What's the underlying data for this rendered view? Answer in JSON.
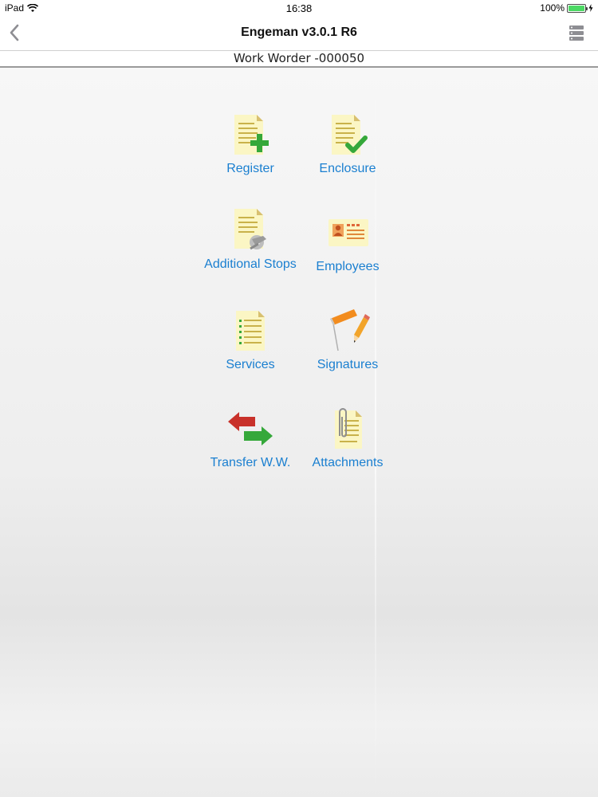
{
  "status": {
    "device": "iPad",
    "time": "16:38",
    "battery": "100%"
  },
  "nav": {
    "title": "Engeman v3.0.1 R6"
  },
  "subheader": {
    "text": "Work Worder -000050"
  },
  "menu": {
    "register": "Register",
    "enclosure": "Enclosure",
    "additional_stops": "Additional Stops",
    "employees": "Employees",
    "services": "Services",
    "signatures": "Signatures",
    "transfer": "Transfer W.W.",
    "attachments": "Attachments"
  },
  "colors": {
    "accent": "#1a7fd0",
    "doc": "#fbf6c4",
    "lines": "#c9b24a",
    "green": "#35a83a",
    "red": "#c8312a"
  }
}
